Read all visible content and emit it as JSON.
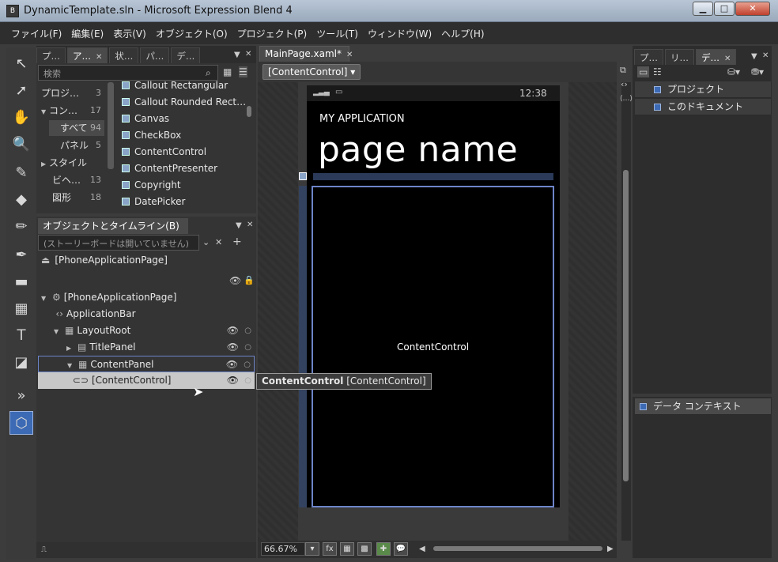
{
  "window": {
    "title": "DynamicTemplate.sln - Microsoft Expression Blend 4",
    "icon_label": "B"
  },
  "menu": [
    "ファイル(F)",
    "編集(E)",
    "表示(V)",
    "オブジェクト(O)",
    "プロジェクト(P)",
    "ツール(T)",
    "ウィンドウ(W)",
    "ヘルプ(H)"
  ],
  "assets_panel": {
    "tabs": [
      "プ…",
      "ア…",
      "状…",
      "パ…",
      "デ…"
    ],
    "active_tab": 1,
    "search_placeholder": "検索",
    "categories": [
      {
        "label": "プロジ…",
        "count": "3"
      },
      {
        "label": "コン…",
        "count": "17"
      },
      {
        "label": "すべて",
        "count": "94"
      },
      {
        "label": "パネル",
        "count": "5"
      },
      {
        "label": "スタイル",
        "count": ""
      },
      {
        "label": "ビヘ…",
        "count": "13"
      },
      {
        "label": "図形",
        "count": "18"
      }
    ],
    "items": [
      "Callout Rectangular",
      "Callout Rounded Rect…",
      "Canvas",
      "CheckBox",
      "ContentControl",
      "ContentPresenter",
      "Copyright",
      "DatePicker"
    ]
  },
  "objects_panel": {
    "title": "オブジェクトとタイムライン(B)",
    "storyboard": "(ストーリーボードは開いていません)",
    "scope": "[PhoneApplicationPage]",
    "tree": [
      {
        "label": "[PhoneApplicationPage]",
        "level": 0
      },
      {
        "label": "ApplicationBar",
        "level": 1
      },
      {
        "label": "LayoutRoot",
        "level": 1
      },
      {
        "label": "TitlePanel",
        "level": 2
      },
      {
        "label": "ContentPanel",
        "level": 2
      },
      {
        "label": "[ContentControl]",
        "level": 3
      }
    ]
  },
  "document": {
    "tab": "MainPage.xaml*",
    "breadcrumb": "[ContentControl]",
    "phone_time": "12:38",
    "app_title": "MY APPLICATION",
    "page_name": "page name",
    "content_label": "ContentControl",
    "tooltip_bold": "ContentControl",
    "tooltip_rest": "[ContentControl]",
    "zoom": "66.67%"
  },
  "right_panel": {
    "tabs": [
      "プ…",
      "リ…",
      "デ…"
    ],
    "active_tab": 2,
    "items": [
      "プロジェクト",
      "このドキュメント"
    ],
    "data_context": "データ コンテキスト"
  },
  "colors": {
    "selection_border": "#6d84c8",
    "selected_row": "#c8c8c8"
  }
}
